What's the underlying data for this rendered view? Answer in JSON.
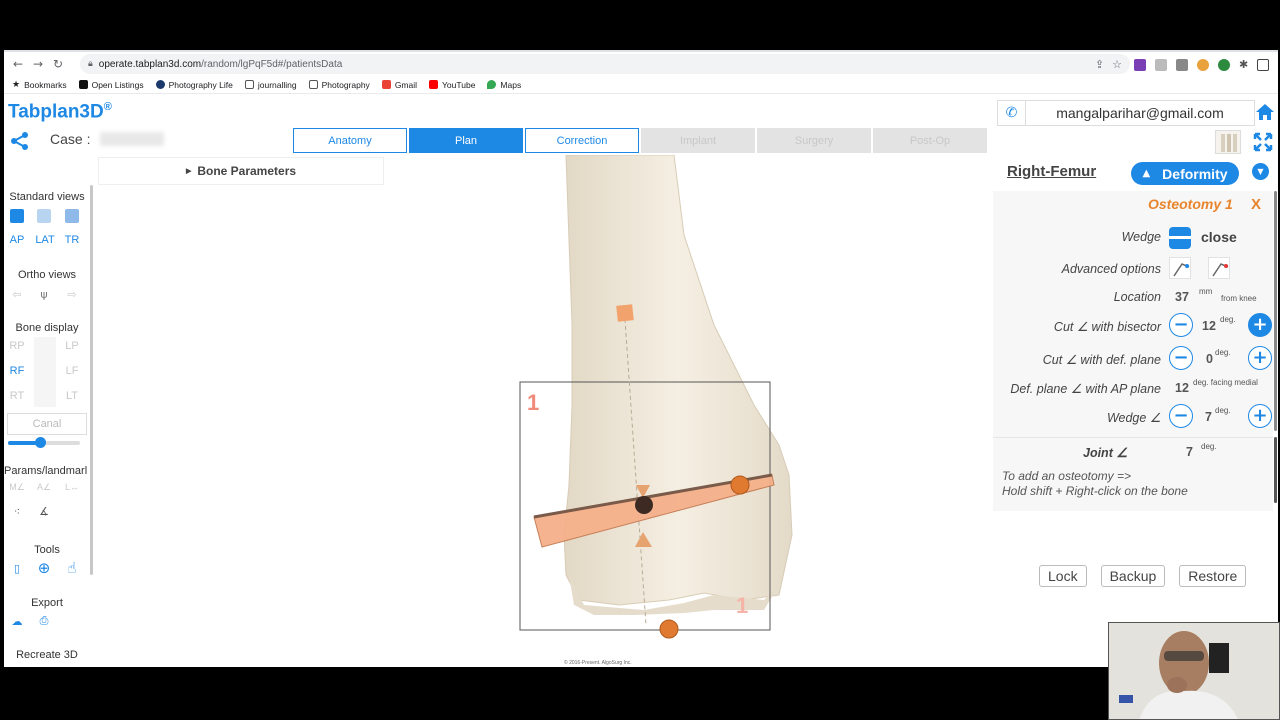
{
  "browser": {
    "url_domain": "operate.tabplan3d.com",
    "url_path": "/random/lgPqF5d#/patientsData",
    "bookmarks": [
      "Bookmarks",
      "Open Listings",
      "Photography Life",
      "journalling",
      "Photography",
      "Gmail",
      "YouTube",
      "Maps"
    ]
  },
  "app": {
    "logo": "Tabplan3D",
    "logo_mark": "®",
    "case_label": "Case :",
    "tabs": [
      "Anatomy",
      "Plan",
      "Correction",
      "Implant",
      "Surgery",
      "Post-Op"
    ],
    "active_tab": "Plan",
    "user_email": "mangalparihar@gmail.com"
  },
  "sidebar": {
    "standard_views": "Standard views",
    "view_buttons": [
      "AP",
      "LAT",
      "TR"
    ],
    "ortho_views": "Ortho views",
    "bone_display": "Bone display",
    "bone_buttons": [
      "RP",
      "LP",
      "RF",
      "LF",
      "RT",
      "LT"
    ],
    "canal": "Canal",
    "opacity_level": 0.45,
    "params_landmarks": "Params/landmarl",
    "param_buttons": [
      "M∠",
      "A∠",
      "L↔"
    ],
    "tools": "Tools",
    "export": "Export",
    "recreate": "Recreate 3D"
  },
  "bone_parameters": "Bone Parameters",
  "viewport": {
    "label_top": "1",
    "label_bottom": "1",
    "copyright": "© 2016-Present. AlgoSurg Inc."
  },
  "panel": {
    "side": "Right-Femur",
    "deformity": "Deformity",
    "osteotomy_title": "Osteotomy 1",
    "close_x": "X",
    "wedge_label": "Wedge",
    "wedge_value": "close",
    "advanced_label": "Advanced options",
    "location_label": "Location",
    "location_value": "37",
    "location_unit": "mm",
    "location_suffix": "from knee",
    "cut_bisector_label": "Cut ∠ with bisector",
    "cut_bisector_value": "12",
    "cut_defplane_label": "Cut ∠ with def. plane",
    "cut_defplane_value": "0",
    "defplane_label": "Def. plane ∠ with AP plane",
    "defplane_value": "12",
    "defplane_suffix": "deg. facing medial",
    "wedge_angle_label": "Wedge ∠",
    "wedge_angle_value": "7",
    "deg": "deg.",
    "joint_label": "Joint ∠",
    "joint_value": "7",
    "hint_line1": "To add an osteotomy =>",
    "hint_line2": "Hold shift + Right-click on the bone",
    "lock": "Lock",
    "backup": "Backup",
    "restore": "Restore"
  },
  "colors": {
    "accent": "#1e88e5",
    "osteotomy": "#e8842c"
  }
}
